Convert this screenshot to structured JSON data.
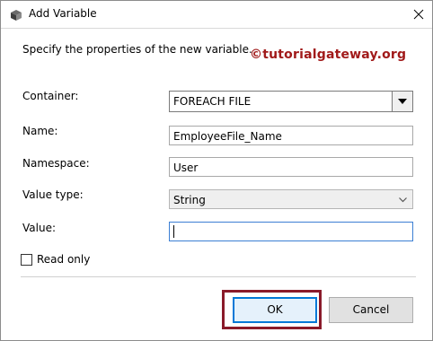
{
  "window": {
    "title": "Add Variable",
    "intro_text": "Specify the properties of the new variable.",
    "watermark": "©tutorialgateway.org"
  },
  "form": {
    "container": {
      "label": "Container:",
      "value": "FOREACH FILE"
    },
    "name": {
      "label": "Name:",
      "value": "EmployeeFile_Name"
    },
    "namespace": {
      "label": "Namespace:",
      "value": "User"
    },
    "value_type": {
      "label": "Value type:",
      "value": "String"
    },
    "value": {
      "label": "Value:",
      "value": ""
    },
    "read_only": {
      "label": "Read only",
      "checked": false
    }
  },
  "buttons": {
    "ok": "OK",
    "cancel": "Cancel"
  },
  "colors": {
    "watermark": "#a11a1a",
    "highlight": "#8a1a2a",
    "focus_border": "#0078d7"
  }
}
